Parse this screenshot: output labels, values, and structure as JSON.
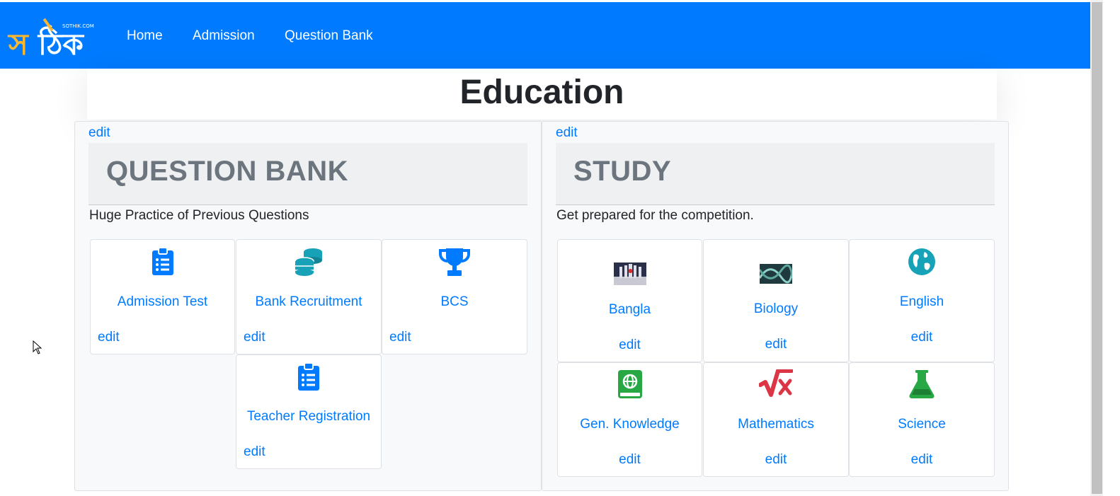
{
  "navbar": {
    "bg_color": "#007bff",
    "logo_text": "সঠিক",
    "logo_small": "SOTHIK.COM",
    "links": [
      "Home",
      "Admission",
      "Question Bank"
    ]
  },
  "page": {
    "title": "Education"
  },
  "edit_label": "edit",
  "question_bank": {
    "title": "QUESTION BANK",
    "lead": "Huge Practice of Previous Questions",
    "cards": [
      {
        "label": "Admission Test",
        "icon": "clipboard-list-icon",
        "color": "#007bff"
      },
      {
        "label": "Bank Recruitment",
        "icon": "coins-icon",
        "color": "#17a2b8"
      },
      {
        "label": "BCS",
        "icon": "trophy-icon",
        "color": "#007bff"
      },
      {
        "label": "Teacher Registration",
        "icon": "clipboard-list-icon",
        "color": "#007bff"
      }
    ]
  },
  "study": {
    "title": "STUDY",
    "lead": "Get prepared for the competition.",
    "cards": [
      {
        "label": "Bangla",
        "icon": "shaheed-minar-thumbnail"
      },
      {
        "label": "Biology",
        "icon": "dna-thumbnail"
      },
      {
        "label": "English",
        "icon": "globe-icon",
        "color": "#17a2b8"
      },
      {
        "label": "Gen. Knowledge",
        "icon": "atlas-book-icon",
        "color": "#28a745"
      },
      {
        "label": "Mathematics",
        "icon": "square-root-icon",
        "color": "#dc3545"
      },
      {
        "label": "Science",
        "icon": "flask-icon",
        "color": "#28a745"
      }
    ]
  }
}
